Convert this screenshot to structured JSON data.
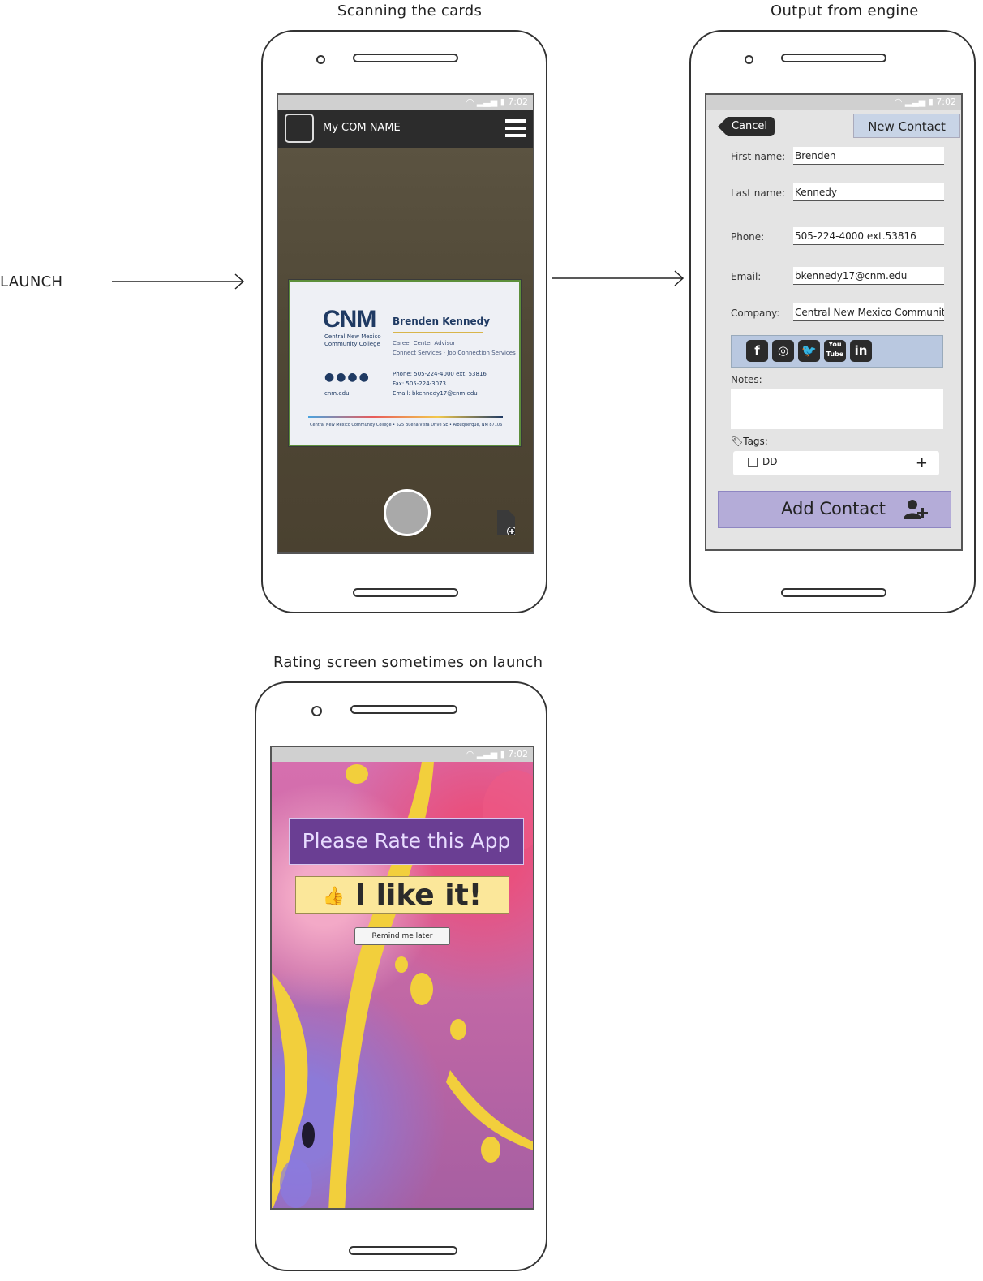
{
  "labels": {
    "scanning": "Scanning the cards",
    "output": "Output from engine",
    "rating": "Rating screen sometimes on launch",
    "launch": "LAUNCH"
  },
  "status_time": "7:02",
  "scan_screen": {
    "app_title": "My COM NAME",
    "card": {
      "logo": "CNM",
      "org_line1": "Central New Mexico",
      "org_line2": "Community College",
      "name": "Brenden Kennedy",
      "title1": "Career Center Advisor",
      "title2": "Connect Services · Job Connection Services",
      "phone": "Phone: 505-224-4000 ext. 53816",
      "fax": "Fax: 505-224-3073",
      "email": "Email: bkennedy17@cnm.edu",
      "site": "cnm.edu",
      "footer": "Central New Mexico Community College • 525 Buena Vista Drive SE • Albuquerque, NM 87106"
    }
  },
  "contact_screen": {
    "cancel": "Cancel",
    "header": "New Contact",
    "fields": {
      "first_label": "First name:",
      "first_value": "Brenden",
      "last_label": "Last name:",
      "last_value": "Kennedy",
      "phone_label": "Phone:",
      "phone_value": "505-224-4000 ext.53816",
      "email_label": "Email:",
      "email_value": "bkennedy17@cnm.edu",
      "company_label": "Company:",
      "company_value": "Central New Mexico Communit"
    },
    "notes_label": "Notes:",
    "tags_label": "Tags:",
    "tag": "DD",
    "add_label": "Add Contact",
    "social_icons": [
      "facebook-icon",
      "instagram-icon",
      "twitter-icon",
      "youtube-icon",
      "linkedin-icon"
    ]
  },
  "rating_screen": {
    "title": "Please Rate this App",
    "like": "I like it!",
    "remind": "Remind me later"
  }
}
